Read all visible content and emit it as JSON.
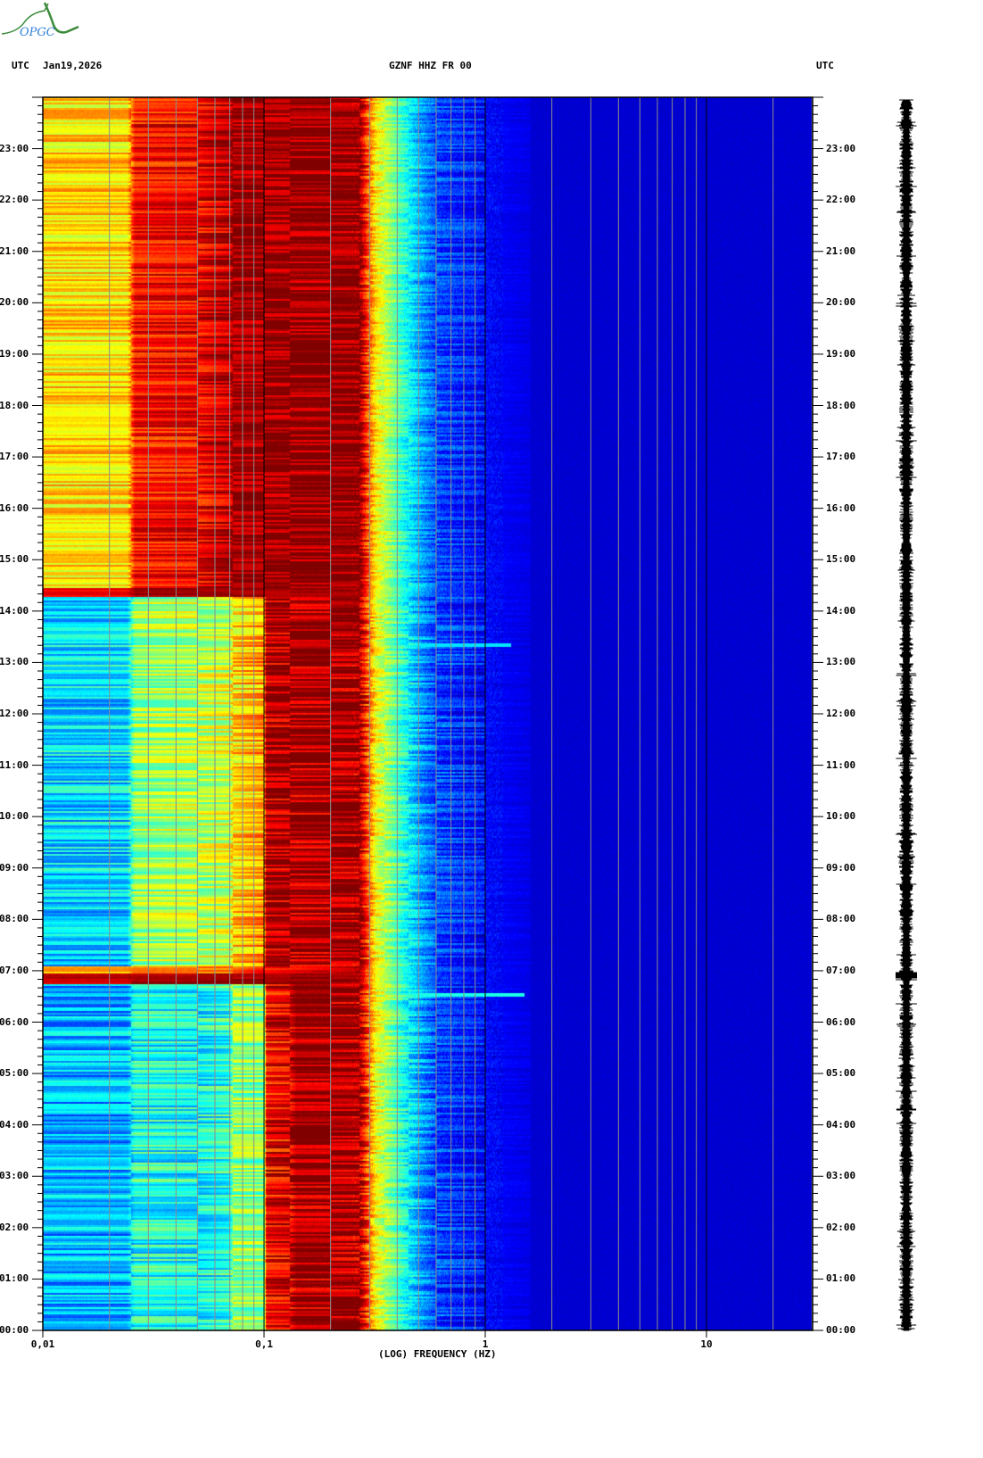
{
  "header": {
    "left_tz": "UTC",
    "date": "Jan19,2026",
    "station": "GZNF HHZ FR 00",
    "right_tz": "UTC"
  },
  "logo": {
    "text": "OPGC"
  },
  "colors": {
    "navy": "#00009c",
    "grid": "#8c8c8c",
    "decade_line": "#000000"
  },
  "chart_data": {
    "type": "heatmap",
    "title": "GZNF HHZ FR 00",
    "xlabel": "(LOG) FREQUENCY (HZ)",
    "ylabel": "UTC",
    "xscale": "log",
    "xlim": [
      0.01,
      30
    ],
    "ylim_hours": [
      0,
      24
    ],
    "x_tick_labels": [
      {
        "value": 0.01,
        "label": "0,01"
      },
      {
        "value": 0.1,
        "label": "0,1"
      },
      {
        "value": 1,
        "label": "1"
      },
      {
        "value": 10,
        "label": "10"
      }
    ],
    "y_tick_labels": [
      "00:00",
      "01:00",
      "02:00",
      "03:00",
      "04:00",
      "05:00",
      "06:00",
      "07:00",
      "08:00",
      "09:00",
      "10:00",
      "11:00",
      "12:00",
      "13:00",
      "14:00",
      "15:00",
      "16:00",
      "17:00",
      "18:00",
      "19:00",
      "20:00",
      "21:00",
      "22:00",
      "23:00"
    ],
    "colormap": "jet",
    "level_units": "normalized power 0-1",
    "segments": [
      {
        "hours": [
          0,
          6.75
        ],
        "profile": [
          [
            0.01,
            0.3
          ],
          [
            0.024,
            0.3
          ],
          [
            0.026,
            0.4
          ],
          [
            0.05,
            0.38
          ],
          [
            0.07,
            0.42
          ],
          [
            0.072,
            0.52
          ],
          [
            0.1,
            0.5
          ],
          [
            0.102,
            0.88
          ],
          [
            0.13,
            0.9
          ],
          [
            0.14,
            0.97
          ],
          [
            0.27,
            0.96
          ],
          [
            0.29,
            0.82
          ],
          [
            0.32,
            0.62
          ],
          [
            0.4,
            0.45
          ],
          [
            0.5,
            0.3
          ],
          [
            0.6,
            0.2
          ],
          [
            1.0,
            0.13
          ],
          [
            1.6,
            0.1
          ],
          [
            30,
            0.1
          ]
        ],
        "noise": 0.12
      },
      {
        "hours": [
          6.75,
          6.95
        ],
        "profile": [
          [
            0.01,
            0.92
          ],
          [
            0.024,
            0.92
          ],
          [
            0.026,
            0.97
          ],
          [
            0.1,
            0.97
          ],
          [
            0.27,
            0.96
          ],
          [
            0.29,
            0.82
          ],
          [
            0.32,
            0.62
          ],
          [
            0.4,
            0.45
          ],
          [
            0.5,
            0.3
          ],
          [
            0.6,
            0.2
          ],
          [
            1.0,
            0.13
          ],
          [
            1.6,
            0.1
          ],
          [
            30,
            0.1
          ]
        ],
        "noise": 0.04
      },
      {
        "hours": [
          6.95,
          7.1
        ],
        "profile": [
          [
            0.01,
            0.7
          ],
          [
            0.024,
            0.7
          ],
          [
            0.026,
            0.75
          ],
          [
            0.07,
            0.75
          ],
          [
            0.1,
            0.85
          ],
          [
            0.27,
            0.96
          ],
          [
            0.29,
            0.82
          ],
          [
            0.32,
            0.62
          ],
          [
            0.4,
            0.45
          ],
          [
            0.5,
            0.3
          ],
          [
            0.6,
            0.2
          ],
          [
            1.0,
            0.13
          ],
          [
            1.6,
            0.1
          ],
          [
            30,
            0.1
          ]
        ],
        "noise": 0.05
      },
      {
        "hours": [
          7.1,
          14.3
        ],
        "profile": [
          [
            0.01,
            0.34
          ],
          [
            0.024,
            0.34
          ],
          [
            0.026,
            0.52
          ],
          [
            0.05,
            0.55
          ],
          [
            0.07,
            0.58
          ],
          [
            0.072,
            0.65
          ],
          [
            0.1,
            0.72
          ],
          [
            0.102,
            0.95
          ],
          [
            0.27,
            0.97
          ],
          [
            0.29,
            0.82
          ],
          [
            0.32,
            0.62
          ],
          [
            0.4,
            0.45
          ],
          [
            0.5,
            0.3
          ],
          [
            0.6,
            0.2
          ],
          [
            1.0,
            0.13
          ],
          [
            1.6,
            0.1
          ],
          [
            30,
            0.1
          ]
        ],
        "noise": 0.12
      },
      {
        "hours": [
          14.3,
          14.45
        ],
        "profile": [
          [
            0.01,
            0.88
          ],
          [
            0.024,
            0.88
          ],
          [
            0.026,
            0.97
          ],
          [
            0.1,
            0.97
          ],
          [
            0.27,
            0.97
          ],
          [
            0.29,
            0.82
          ],
          [
            0.32,
            0.62
          ],
          [
            0.4,
            0.45
          ],
          [
            0.5,
            0.3
          ],
          [
            0.6,
            0.2
          ],
          [
            1.0,
            0.13
          ],
          [
            1.6,
            0.1
          ],
          [
            30,
            0.1
          ]
        ],
        "noise": 0.03
      },
      {
        "hours": [
          14.45,
          24
        ],
        "profile": [
          [
            0.01,
            0.66
          ],
          [
            0.024,
            0.66
          ],
          [
            0.026,
            0.86
          ],
          [
            0.05,
            0.88
          ],
          [
            0.07,
            0.94
          ],
          [
            0.072,
            0.98
          ],
          [
            0.27,
            0.98
          ],
          [
            0.29,
            0.82
          ],
          [
            0.32,
            0.64
          ],
          [
            0.4,
            0.46
          ],
          [
            0.5,
            0.3
          ],
          [
            0.6,
            0.2
          ],
          [
            1.0,
            0.13
          ],
          [
            1.6,
            0.1
          ],
          [
            30,
            0.1
          ]
        ],
        "noise": 0.1
      }
    ],
    "transients": [
      {
        "hour": 6.55,
        "freq_range": [
          0.3,
          1.5
        ],
        "level": 0.4
      },
      {
        "hour": 13.35,
        "freq_range": [
          0.3,
          1.3
        ],
        "level": 0.35
      }
    ]
  }
}
